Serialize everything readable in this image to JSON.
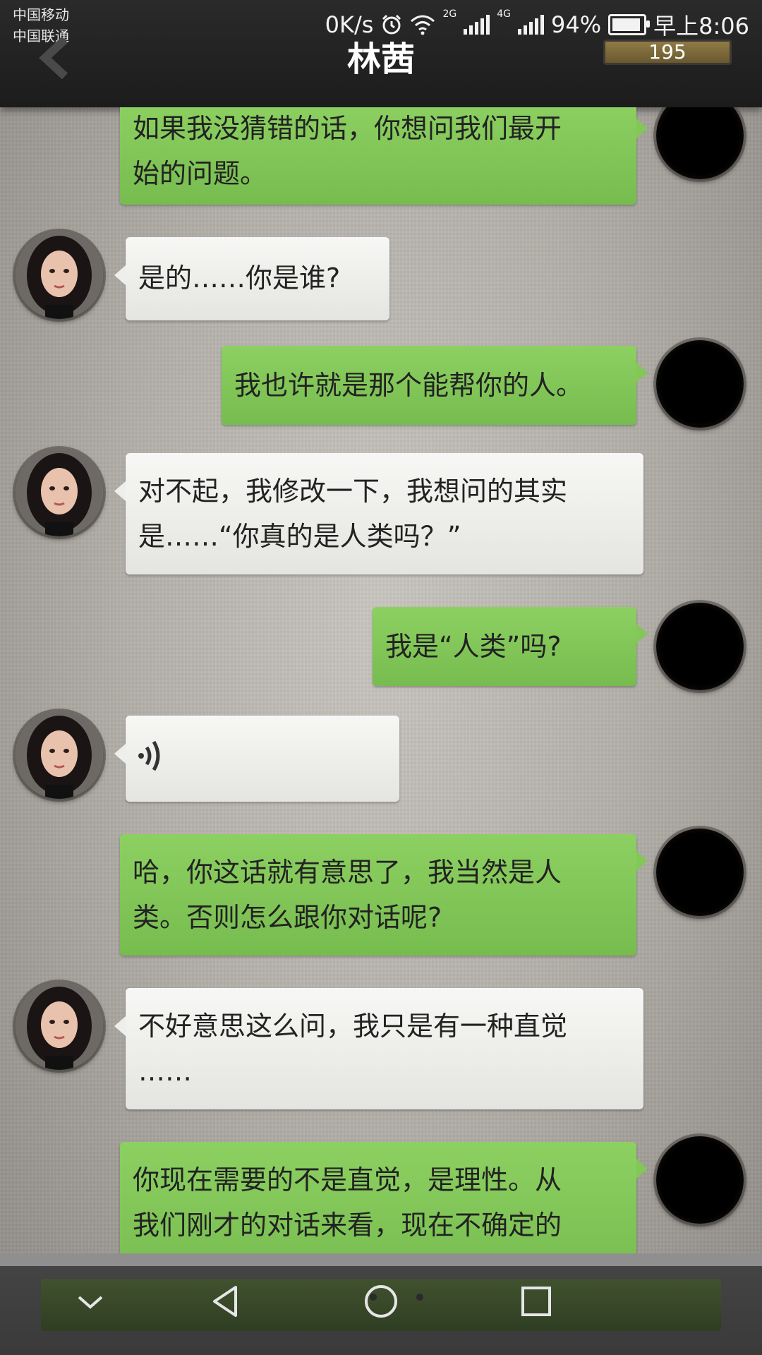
{
  "status_bar": {
    "carrier_1": "中国移动",
    "carrier_2": "中国联通",
    "net_speed": "0K/s",
    "net_2g": "2G",
    "net_4g": "4G",
    "battery": "94%",
    "time": "早上8:06"
  },
  "header": {
    "title": "林茜",
    "score": "195"
  },
  "messages": [
    {
      "side": "right",
      "text_lines": [
        "如果我没猜错的话，你想问我们最开",
        "始的问题。"
      ]
    },
    {
      "side": "left",
      "text_lines": [
        "是的……你是谁?"
      ]
    },
    {
      "side": "right",
      "text_lines": [
        "我也许就是那个能帮你的人。"
      ]
    },
    {
      "side": "left",
      "text_lines": [
        "对不起，我修改一下，我想问的其实",
        "是……“你真的是人类吗？”"
      ]
    },
    {
      "side": "right",
      "text_lines": [
        "我是“人类”吗?"
      ]
    },
    {
      "side": "left",
      "voice": true,
      "icon": "voice-wave-icon"
    },
    {
      "side": "right",
      "text_lines": [
        "哈，你这话就有意思了，我当然是人",
        "类。否则怎么跟你对话呢?"
      ]
    },
    {
      "side": "left",
      "text_lines": [
        "不好意思这么问，我只是有一种直觉",
        "……"
      ]
    },
    {
      "side": "right",
      "text_lines": [
        "你现在需要的不是直觉，是理性。从",
        "我们刚才的对话来看，现在不确定的"
      ]
    }
  ],
  "nav": {
    "icons": [
      "chevron-down-icon",
      "back-triangle-icon",
      "home-circle-icon",
      "recent-square-icon"
    ]
  },
  "colors": {
    "green_bubble": "#82c757",
    "white_bubble": "#eeeeeb",
    "header_bg": "#222222",
    "score_bar": "#7d6a3a"
  }
}
